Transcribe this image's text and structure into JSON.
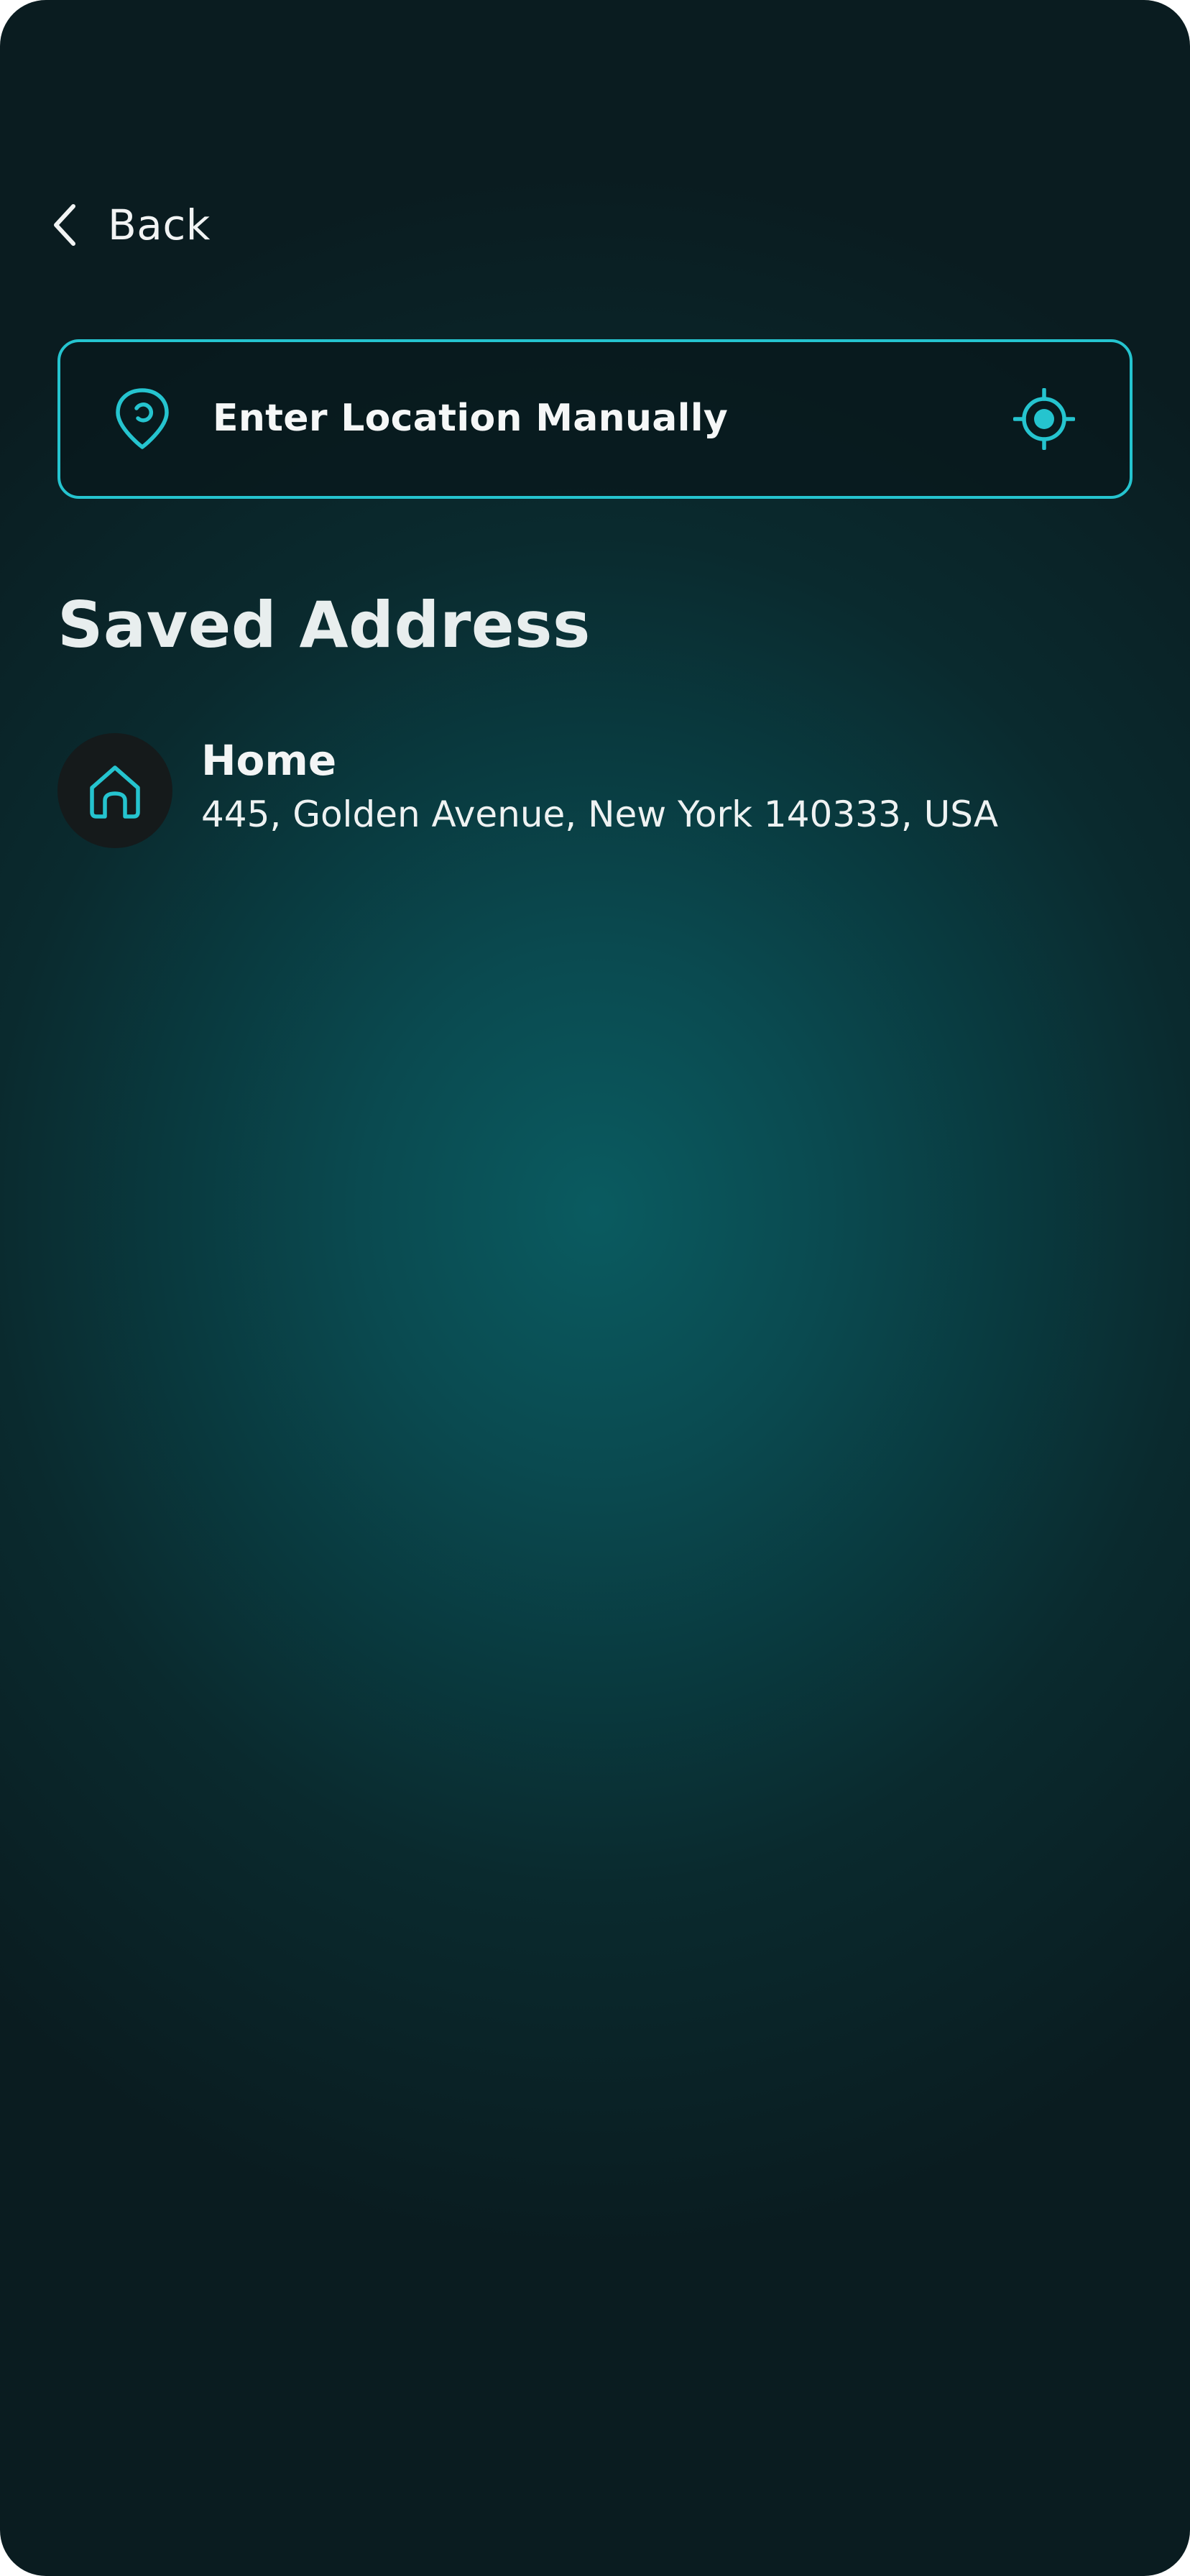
{
  "colors": {
    "accent": "#25c4cf",
    "background_center": "#0a5b60",
    "background_edge": "#0a1c20",
    "avatar_bg": "#151a1b",
    "text_primary": "#f3f5f5"
  },
  "header": {
    "back_icon": "chevron-left-icon",
    "back_label": "Back"
  },
  "location_input": {
    "leading_icon": "location-pin-icon",
    "label": "Enter Location Manually",
    "trailing_icon": "gps-target-icon"
  },
  "saved_addresses": {
    "title": "Saved Address",
    "items": [
      {
        "icon": "home-icon",
        "name": "Home",
        "address": "445, Golden Avenue, New York 140333, USA"
      }
    ]
  }
}
